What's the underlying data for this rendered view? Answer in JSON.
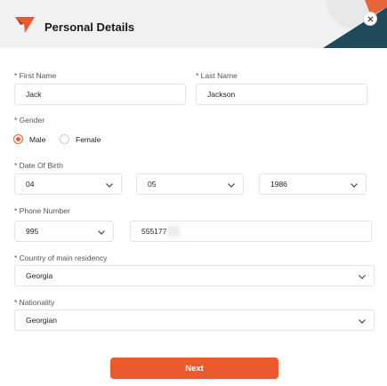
{
  "header": {
    "title": "Personal Details",
    "logo_icon": "brand-arrow-logo-icon",
    "close_icon": "close-icon",
    "accent_color": "#ea5a2d",
    "deco_color": "#1f4a5a"
  },
  "form": {
    "first_name": {
      "label": "* First Name",
      "value": "Jack"
    },
    "last_name": {
      "label": "* Last Name",
      "value": "Jackson"
    },
    "gender": {
      "label": "* Gender",
      "options": [
        {
          "label": "Male",
          "selected": true
        },
        {
          "label": "Female",
          "selected": false
        }
      ]
    },
    "date_of_birth": {
      "label": "* Date Of Birth",
      "day": "04",
      "month": "05",
      "year": "1986"
    },
    "phone_number": {
      "label": "* Phone Number",
      "code": "995",
      "number": "555177"
    },
    "country": {
      "label": "* Country of main residency",
      "value": "Georgia"
    },
    "nationality": {
      "label": "* Nationality",
      "value": "Georgian"
    }
  },
  "actions": {
    "next_label": "Next"
  }
}
